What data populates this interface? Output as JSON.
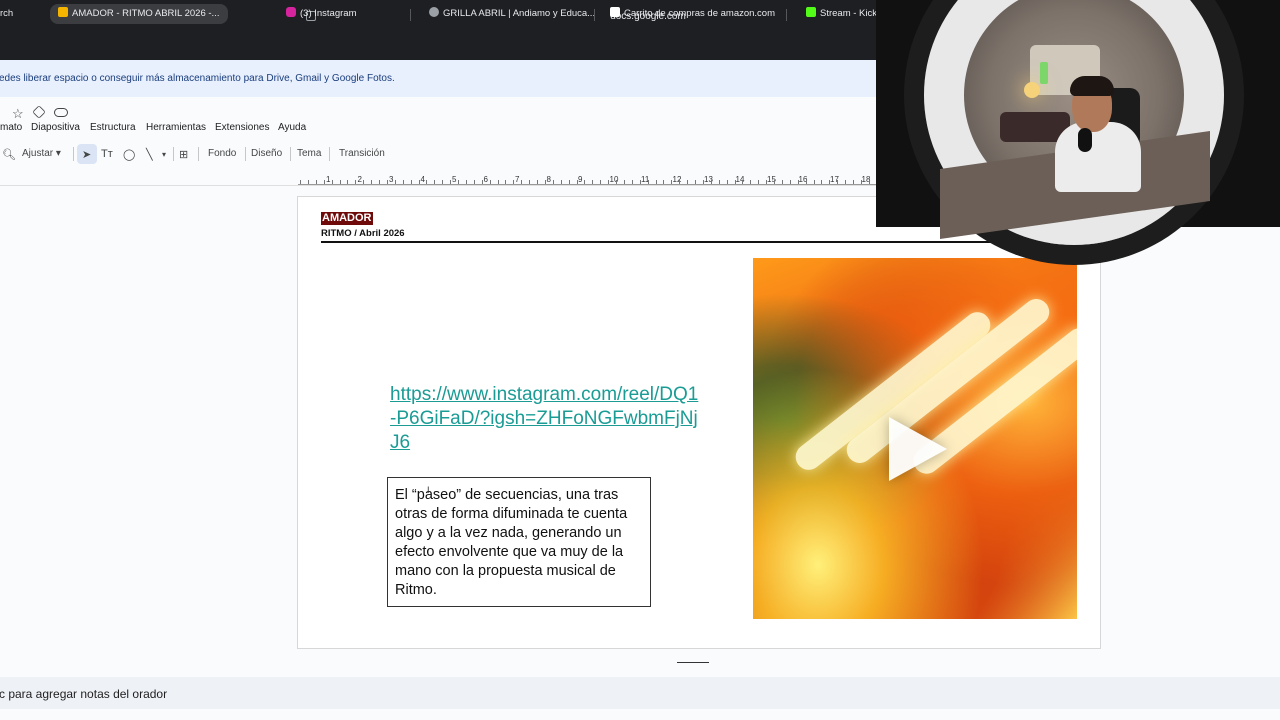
{
  "browser": {
    "url": "docs.google.com",
    "tabs": [
      {
        "label": "rch"
      },
      {
        "label": "AMADOR - RITMO ABRIL 2026 -...",
        "active": true
      },
      {
        "label": "(3) Instagram"
      },
      {
        "label": "GRILLA ABRIL | Andiamo y Educa..."
      },
      {
        "label": "Carrito de compras de amazon.com"
      },
      {
        "label": "Stream - Kick"
      }
    ]
  },
  "banner": {
    "text": "edes liberar espacio o conseguir más almacenamiento para Drive, Gmail y Google Fotos."
  },
  "menu": {
    "items": [
      "mato",
      "Diapositiva",
      "Estructura",
      "Herramientas",
      "Extensiones",
      "Ayuda"
    ]
  },
  "toolbar": {
    "zoom_label": "Ajustar",
    "fondo": "Fondo",
    "diseno": "Diseño",
    "tema": "Tema",
    "transicion": "Transición"
  },
  "ruler": {
    "numbers": [
      "1",
      "2",
      "3",
      "4",
      "5",
      "6",
      "7",
      "8",
      "9",
      "10",
      "11",
      "12",
      "13",
      "14",
      "15",
      "16",
      "17",
      "18"
    ]
  },
  "slide": {
    "brand": "AMADOR",
    "subtitle": "RITMO / Abril 2026",
    "link": "https://www.instagram.com/reel/DQ1-P6GiFaD/?igsh=ZHFoNGFwbmFjNjJ6",
    "body": "El “paseo” de secuencias, una tras otras de forma difuminada te cuenta algo y a la vez nada, generando un efecto envolvente que va muy de la mano con la propuesta musical de Ritmo."
  },
  "notes": {
    "placeholder": "c para agregar notas del orador"
  },
  "colors": {
    "brand_bg": "#6e0a0a",
    "link": "#1a9c95",
    "banner_bg": "#e8f0fe"
  }
}
